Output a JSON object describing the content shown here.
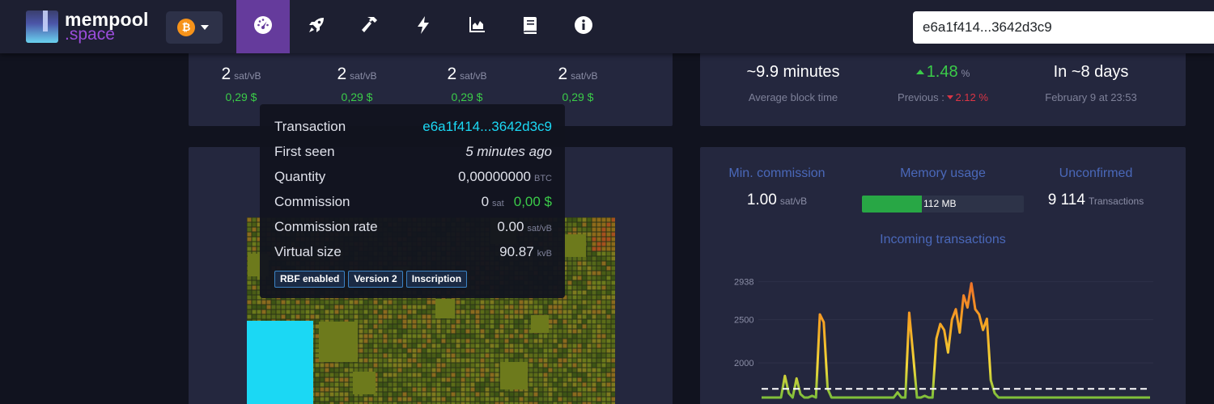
{
  "logo": {
    "line1": "mempool",
    "line2": ".space"
  },
  "network": {
    "icon": "bitcoin-icon",
    "symbol": "₿"
  },
  "nav": [
    {
      "name": "dashboard-icon",
      "active": true
    },
    {
      "name": "rocket-icon",
      "active": false
    },
    {
      "name": "hammer-icon",
      "active": false
    },
    {
      "name": "lightning-icon",
      "active": false
    },
    {
      "name": "graphs-icon",
      "active": false
    },
    {
      "name": "docs-icon",
      "active": false
    },
    {
      "name": "info-icon",
      "active": false
    }
  ],
  "search": {
    "value": "e6a1f414...3642d3c9"
  },
  "fees": [
    {
      "value": "2",
      "unit": "sat/vB",
      "usd": "0,29 $"
    },
    {
      "value": "2",
      "unit": "sat/vB",
      "usd": "0,29 $"
    },
    {
      "value": "2",
      "unit": "sat/vB",
      "usd": "0,29 $"
    },
    {
      "value": "2",
      "unit": "sat/vB",
      "usd": "0,29 $"
    }
  ],
  "difficulty": {
    "block_time": "~9.9 minutes",
    "block_time_label": "Average block time",
    "change": "1.48",
    "change_unit": "%",
    "previous_label": "Previous :",
    "previous_value": "2.12",
    "previous_unit": "%",
    "eta": "In ~8 days",
    "eta_date": "February 9 at 23:53"
  },
  "tooltip": {
    "transaction_label": "Transaction",
    "transaction_value": "e6a1f414...3642d3c9",
    "first_seen_label": "First seen",
    "first_seen_value": "5 minutes ago",
    "quantity_label": "Quantity",
    "quantity_value": "0,00000000",
    "quantity_unit": "BTC",
    "commission_label": "Commission",
    "commission_value": "0",
    "commission_unit": "sat",
    "commission_usd": "0,00 $",
    "rate_label": "Commission rate",
    "rate_value": "0.00",
    "rate_unit": "sat/vB",
    "vsize_label": "Virtual size",
    "vsize_value": "90.87",
    "vsize_unit": "kvB",
    "badges": [
      "RBF enabled",
      "Version 2",
      "Inscription"
    ]
  },
  "stats": {
    "min_commission_label": "Min. commission",
    "min_commission_value": "1.00",
    "min_commission_unit": "sat/vB",
    "memory_label": "Memory usage",
    "memory_value": "112 MB",
    "memory_fraction": 0.37,
    "unconfirmed_label": "Unconfirmed",
    "unconfirmed_value": "9 114",
    "unconfirmed_unit": "Transactions",
    "incoming_title": "Incoming transactions"
  },
  "colors": {
    "accent": "#653b9c",
    "green": "#3bcc49",
    "red": "#dc3545",
    "link": "#1bd8f4",
    "title_blue": "#4a68b9"
  },
  "chart_data": {
    "type": "line",
    "title": "Incoming transactions",
    "ytick_labels": [
      "2938",
      "2500",
      "2000"
    ],
    "ylim": [
      1600,
      3000
    ],
    "threshold": 1700,
    "x": [
      0,
      1,
      2,
      3,
      4,
      5,
      6,
      7,
      8,
      9,
      10,
      11,
      12,
      13,
      14,
      15,
      16,
      17,
      18,
      19,
      20,
      21,
      22,
      23,
      24,
      25,
      26,
      27,
      28,
      29,
      30,
      31,
      32,
      33,
      34,
      35,
      36,
      37,
      38,
      39,
      40,
      41,
      42,
      43,
      44,
      45,
      46,
      47,
      48,
      49,
      50,
      51,
      52,
      53,
      54,
      55,
      56,
      57,
      58,
      59,
      60,
      61,
      62,
      63,
      64,
      65,
      66,
      67,
      68,
      69,
      70,
      71,
      72,
      73,
      74,
      75,
      76,
      77,
      78,
      79,
      80,
      81,
      82,
      83,
      84,
      85,
      86,
      87,
      88,
      89,
      90,
      91,
      92,
      93,
      94,
      95,
      96,
      97,
      98,
      99,
      100
    ],
    "series": [
      {
        "values": [
          1600,
          1600,
          1600,
          1600,
          1600,
          1600,
          1850,
          1650,
          1600,
          1820,
          1640,
          1600,
          1600,
          1620,
          1600,
          2560,
          2470,
          1700,
          1600,
          1600,
          1600,
          1600,
          1600,
          1600,
          1600,
          1600,
          1600,
          1600,
          1600,
          1600,
          1600,
          1600,
          1600,
          1600,
          1600,
          1660,
          1600,
          1600,
          2580,
          2100,
          1600,
          1600,
          1620,
          1600,
          1600,
          2280,
          2450,
          2380,
          2120,
          2500,
          2620,
          2350,
          2780,
          2640,
          2920,
          2620,
          2560,
          2380,
          2510,
          1800,
          1650,
          1600,
          1600,
          1600,
          1600,
          1600,
          1600,
          1600,
          1600,
          1600,
          1600,
          1600,
          1600,
          1600,
          1600,
          1600,
          1600,
          1600,
          1600,
          1600,
          1600,
          1600,
          1600,
          1600,
          1600,
          1600,
          1600,
          1600,
          1600,
          1600,
          1600,
          1600,
          1600,
          1600,
          1600,
          1600,
          1600,
          1600,
          1600,
          1600,
          1600
        ]
      }
    ]
  }
}
